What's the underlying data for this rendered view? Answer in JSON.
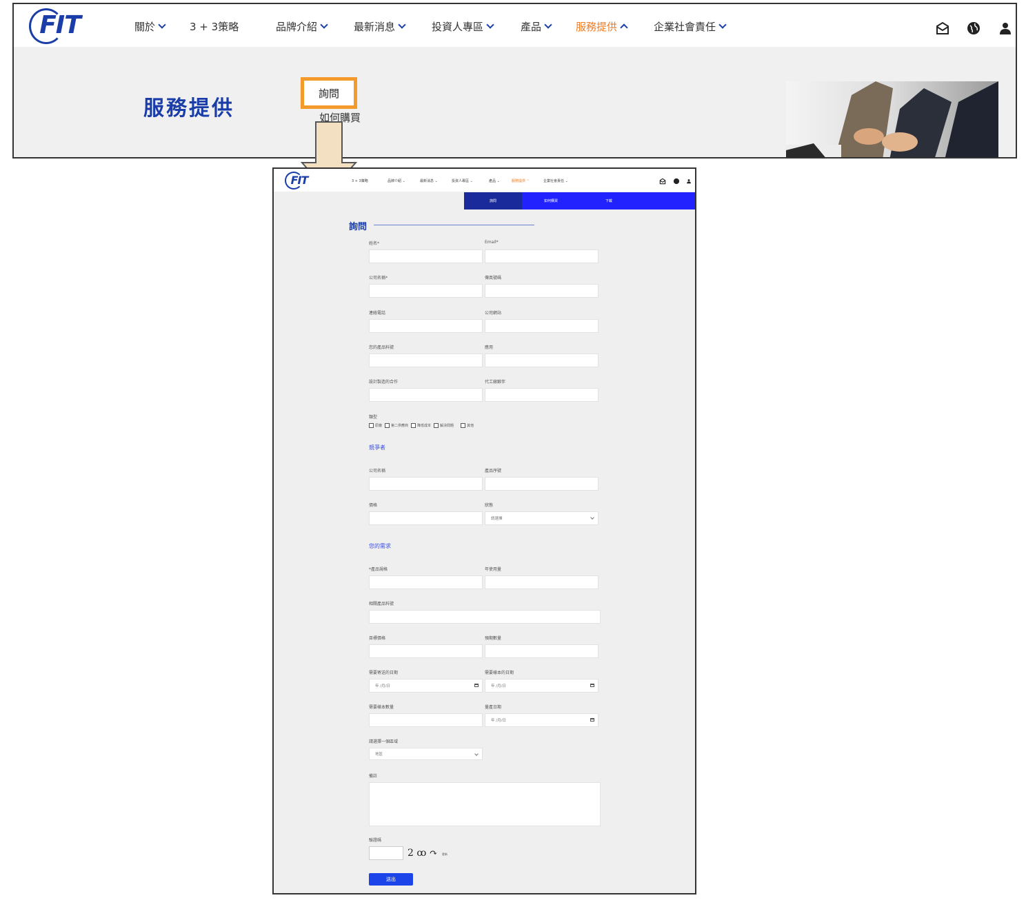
{
  "brand": {
    "logo_text": "FIT"
  },
  "top_nav": {
    "items": [
      {
        "label": "關於"
      },
      {
        "label": "3 + 3策略"
      },
      {
        "label": "品牌介紹"
      },
      {
        "label": "最新消息"
      },
      {
        "label": "投資人專區"
      },
      {
        "label": "產品"
      },
      {
        "label": "服務提供"
      },
      {
        "label": "企業社會責任"
      }
    ],
    "active": "服務提供",
    "icons": [
      "mail-icon",
      "globe-icon",
      "user-icon"
    ]
  },
  "hero": {
    "title": "服務提供",
    "menu": [
      "詢問",
      "如何購買"
    ]
  },
  "bottom": {
    "nav_items": [
      "3 + 3策略",
      "品牌介紹 ⌄",
      "最新消息 ⌄",
      "投資人專區 ⌄",
      "產品 ⌄",
      "服務提供 ⌃",
      "企業社會責任 ⌄"
    ],
    "subnav": [
      "詢問",
      "如何購買",
      "下載"
    ],
    "form": {
      "title": "詢問",
      "fields": {
        "name": "姓名*",
        "email": "Email*",
        "company": "公司名稱*",
        "fax": "傳真號碼",
        "phone": "連絡電話",
        "website": "公司網站",
        "product_no": "您的產品料號",
        "usage": "應用",
        "design_partner": "設計製造的合作",
        "manufacturer": "代工廠夥伴",
        "type": "類型",
        "types": [
          "原廠",
          "第二供應商",
          "降低成本",
          "解決問題",
          "其他"
        ],
        "competitor_section": "競爭者",
        "comp_company": "公司名稱",
        "comp_part": "產品序號",
        "price": "價格",
        "status": "狀態",
        "status_placeholder": "請選擇",
        "needs_section": "您的需求",
        "product_spec": "*產品規格",
        "annual_usage": "年使用量",
        "project_part": "相關產品料號",
        "target_price": "目標價格",
        "expected_qty": "預期數量",
        "sample_date": "需要寄送的日期",
        "sample_ship_date": "需要樣本的日期",
        "date_placeholder": "年 /月/日",
        "sample_qty": "需要樣本數量",
        "mp_date": "量產日期",
        "region": "請選擇一個區域",
        "region_value": "地區",
        "notes": "備註",
        "captcha_label": "驗證碼",
        "captcha_text": "2 ꝏ ↷",
        "captcha_refresh": "更新",
        "submit": "送出"
      }
    }
  }
}
